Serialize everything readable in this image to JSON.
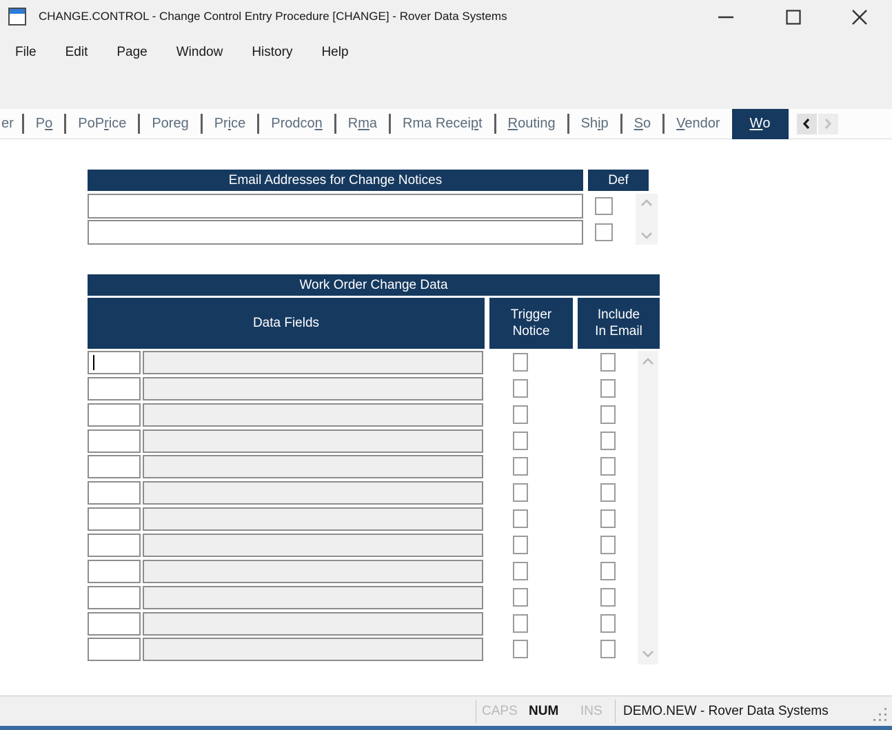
{
  "window": {
    "title": "CHANGE.CONTROL - Change Control Entry Procedure [CHANGE] - Rover Data Systems"
  },
  "menu": {
    "items": [
      "File",
      "Edit",
      "Page",
      "Window",
      "History",
      "Help"
    ]
  },
  "toolbar": {
    "icons": [
      "new-document",
      "save",
      "cut",
      "copy",
      "paste",
      "insert-row",
      "delete-row",
      "attachment",
      "help"
    ],
    "right_icons": [
      "find-preview",
      "window-layout"
    ],
    "search": {
      "value": "",
      "placeholder": ""
    }
  },
  "tab_bar": {
    "tabs": [
      {
        "label": "er",
        "underline": -1,
        "selected": false,
        "partial": true
      },
      {
        "label": "Po",
        "underline": 1,
        "selected": false
      },
      {
        "label": "PoPrice",
        "underline": 3,
        "selected": false
      },
      {
        "label": "Poreg",
        "underline": 4,
        "selected": false
      },
      {
        "label": "Price",
        "underline": 2,
        "selected": false
      },
      {
        "label": "Prodcon",
        "underline": 6,
        "selected": false
      },
      {
        "label": "Rma",
        "underline": 1,
        "selected": false
      },
      {
        "label": "Rma Receipt",
        "underline": 9,
        "selected": false
      },
      {
        "label": "Routing",
        "underline": 0,
        "selected": false
      },
      {
        "label": "Ship",
        "underline": 2,
        "selected": false
      },
      {
        "label": "So",
        "underline": 0,
        "selected": false
      },
      {
        "label": "Vendor",
        "underline": 0,
        "selected": false
      },
      {
        "label": "Wo",
        "underline": 0,
        "selected": true
      }
    ]
  },
  "email_section": {
    "header": "Email Addresses for Change Notices",
    "def_header": "Def",
    "rows": [
      {
        "email": "",
        "def": false
      },
      {
        "email": "",
        "def": false
      }
    ]
  },
  "work_order_section": {
    "header": "Work Order Change Data",
    "data_fields_header": "Data Fields",
    "trigger_header_line1": "Trigger",
    "trigger_header_line2": "Notice",
    "include_header_line1": "Include",
    "include_header_line2": "In Email",
    "rows": [
      {
        "field": "",
        "description": "",
        "trigger": false,
        "include": false
      },
      {
        "field": "",
        "description": "",
        "trigger": false,
        "include": false
      },
      {
        "field": "",
        "description": "",
        "trigger": false,
        "include": false
      },
      {
        "field": "",
        "description": "",
        "trigger": false,
        "include": false
      },
      {
        "field": "",
        "description": "",
        "trigger": false,
        "include": false
      },
      {
        "field": "",
        "description": "",
        "trigger": false,
        "include": false
      },
      {
        "field": "",
        "description": "",
        "trigger": false,
        "include": false
      },
      {
        "field": "",
        "description": "",
        "trigger": false,
        "include": false
      },
      {
        "field": "",
        "description": "",
        "trigger": false,
        "include": false
      },
      {
        "field": "",
        "description": "",
        "trigger": false,
        "include": false
      },
      {
        "field": "",
        "description": "",
        "trigger": false,
        "include": false
      },
      {
        "field": "",
        "description": "",
        "trigger": false,
        "include": false
      }
    ]
  },
  "status_bar": {
    "indicators": [
      {
        "label": "CAPS",
        "active": false
      },
      {
        "label": "NUM",
        "active": true
      },
      {
        "label": "INS",
        "active": false
      }
    ],
    "session": "DEMO.NEW - Rover Data Systems"
  },
  "colors": {
    "navy": "#16395f",
    "icon_blue": "#2e7cd6",
    "row_icon_blue": "#3a78c2",
    "help_blue": "#3d7ebf",
    "paperclip_blue": "#8fb2dd",
    "orange": "#f0a030",
    "red": "#cc2f2f",
    "window_border_blue": "#3a6ca3",
    "disabled_field": "#efefef"
  }
}
